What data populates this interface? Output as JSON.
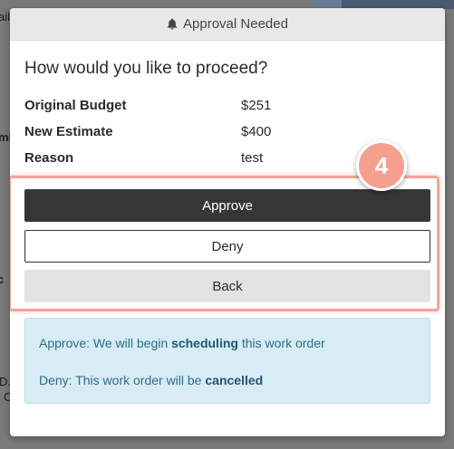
{
  "background": {
    "fragments": [
      "ail",
      "ml",
      "c",
      "D.",
      "C"
    ]
  },
  "modal": {
    "header": {
      "icon": "bell-icon",
      "title": "Approval Needed"
    },
    "question": "How would you like to proceed?",
    "details": [
      {
        "label": "Original Budget",
        "value": "$251"
      },
      {
        "label": "New Estimate",
        "value": "$400"
      },
      {
        "label": "Reason",
        "value": "test"
      }
    ],
    "buttons": {
      "approve": "Approve",
      "deny": "Deny",
      "back": "Back"
    },
    "step_badge": "4",
    "info": {
      "approve_prefix": "Approve: We will begin ",
      "approve_bold": "scheduling",
      "approve_suffix": " this work order",
      "deny_prefix": "Deny: This work order will be ",
      "deny_bold": "cancelled"
    }
  },
  "colors": {
    "approve_button": "#363636",
    "highlight": "#f3a596",
    "info_background": "#d7ecf4",
    "info_text": "#2f6b86"
  }
}
